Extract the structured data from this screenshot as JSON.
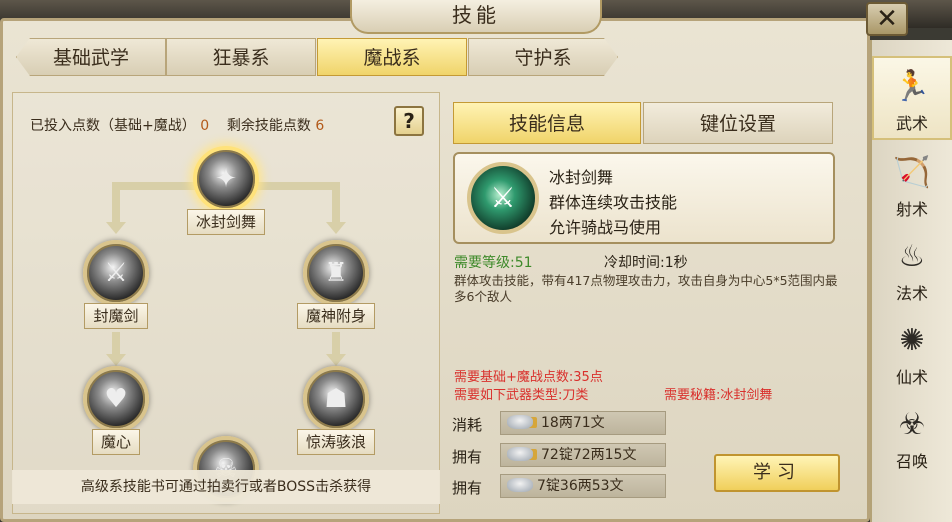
{
  "window": {
    "title": "技能"
  },
  "top_tabs": [
    {
      "label": "基础武学",
      "active": false
    },
    {
      "label": "狂暴系",
      "active": false
    },
    {
      "label": "魔战系",
      "active": true
    },
    {
      "label": "守护系",
      "active": false
    }
  ],
  "points": {
    "invested_label": "已投入点数（基础+魔战）",
    "invested_value": "0",
    "remaining_label": "剩余技能点数",
    "remaining_value": "6",
    "help_label": "?"
  },
  "skill_tree": {
    "nodes": [
      {
        "name": "冰封剑舞",
        "icon": "sword-dance-icon"
      },
      {
        "name": "封魔剑",
        "icon": "sword-icon"
      },
      {
        "name": "魔神附身",
        "icon": "demon-armor-icon"
      },
      {
        "name": "魔心",
        "icon": "demon-heart-icon"
      },
      {
        "name": "惊涛骇浪",
        "icon": "stone-wave-icon"
      },
      {
        "name": "",
        "icon": "skull-icon"
      }
    ],
    "bottom_note": "高级系技能书可通过拍卖行或者BOSS击杀获得"
  },
  "right_tabs": [
    {
      "label": "技能信息",
      "active": true
    },
    {
      "label": "键位设置",
      "active": false
    }
  ],
  "skill_info": {
    "name": "冰封剑舞",
    "type": "群体连续攻击技能",
    "mount_note": "允许骑战马使用",
    "required_level": "需要等级:51",
    "cooldown": "冷却时间:1秒",
    "description": "群体攻击技能，带有417点物理攻击力，攻击自身为中心5*5范围内最多6个敌人",
    "req_points": "需要基础+魔战点数:35点",
    "req_weapon": "需要如下武器类型:刀类",
    "req_book": "需要秘籍:冰封剑舞"
  },
  "costs": [
    {
      "label": "消耗",
      "value": "18两71文",
      "locked": true
    },
    {
      "label": "拥有",
      "value": "72锭72两15文",
      "locked": true
    },
    {
      "label": "拥有",
      "value": "7锭36两53文",
      "locked": false
    }
  ],
  "learn_button": "学习",
  "side_tabs": [
    {
      "label": "武术",
      "icon": "martial-arts-icon",
      "active": true
    },
    {
      "label": "射术",
      "icon": "archery-icon",
      "active": false
    },
    {
      "label": "法术",
      "icon": "magic-gourd-icon",
      "active": false
    },
    {
      "label": "仙术",
      "icon": "immortal-swirl-icon",
      "active": false
    },
    {
      "label": "召唤",
      "icon": "summon-beast-icon",
      "active": false
    }
  ],
  "colors": {
    "active_tab": "#f0d46a",
    "green_text": "#3e8a2a",
    "red_text": "#d9302c",
    "number_orange": "#b35a1a"
  }
}
